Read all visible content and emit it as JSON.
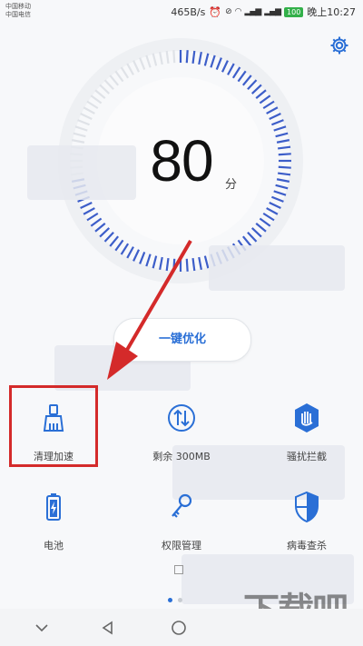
{
  "status_bar": {
    "carrier_1": "中国移动",
    "carrier_2": "中国电信",
    "speed": "465B/s",
    "battery": "100",
    "time": "晚上10:27"
  },
  "score": {
    "value": "80",
    "unit": "分"
  },
  "optimize_button": {
    "label": "一键优化"
  },
  "tiles": [
    {
      "label": "清理加速",
      "icon": "broom-icon"
    },
    {
      "label": "剩余 300MB",
      "icon": "data-arrows-icon"
    },
    {
      "label": "骚扰拦截",
      "icon": "hand-shield-icon"
    },
    {
      "label": "电池",
      "icon": "battery-icon"
    },
    {
      "label": "权限管理",
      "icon": "key-icon"
    },
    {
      "label": "病毒查杀",
      "icon": "shield-icon"
    }
  ],
  "watermark": {
    "text": "下载吧"
  },
  "colors": {
    "accent": "#2a6fd6",
    "highlight": "#d42a2a",
    "arrow": "#d42a2a"
  }
}
